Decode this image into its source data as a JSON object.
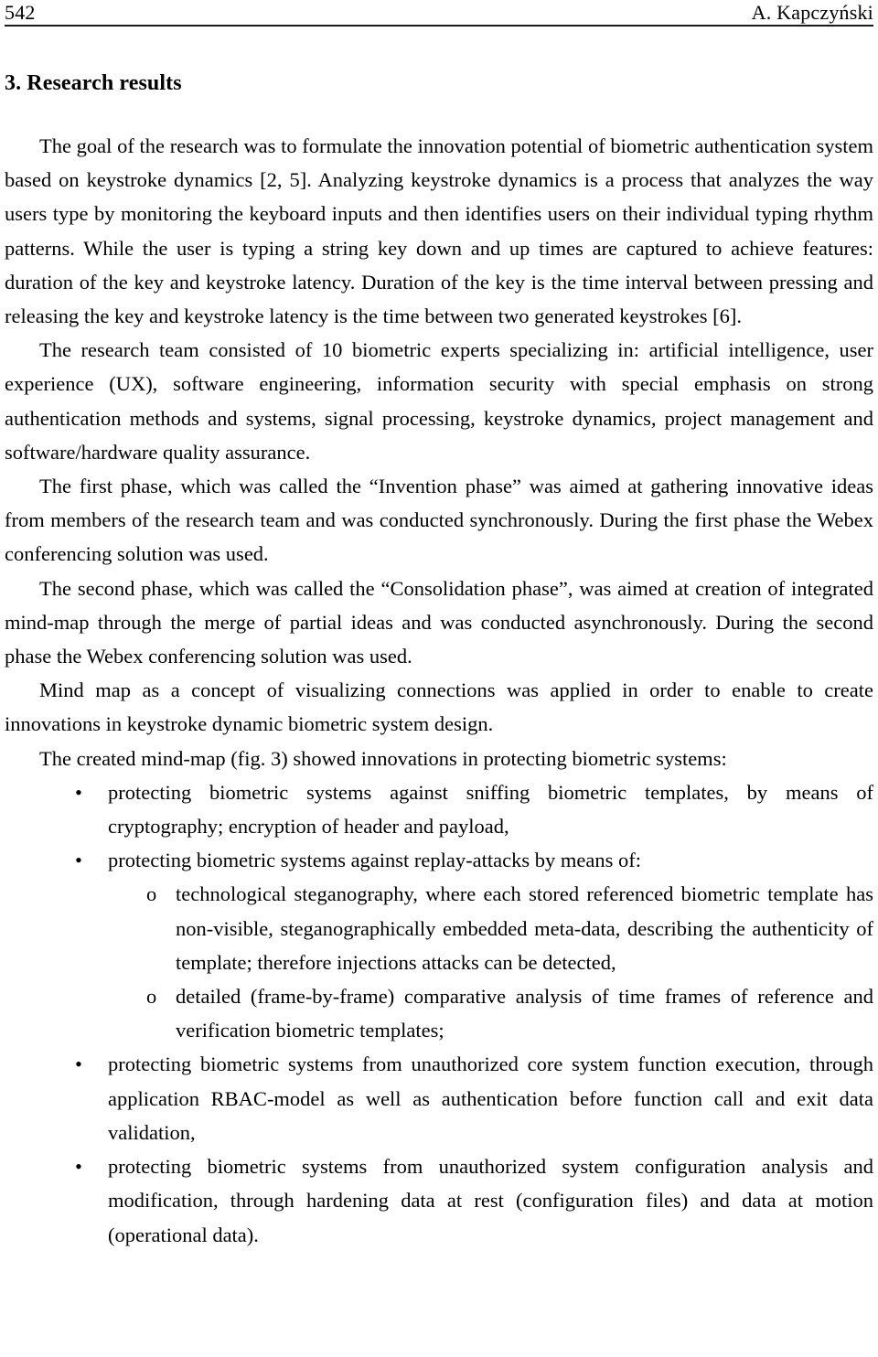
{
  "header": {
    "folio": "542",
    "author": "A. Kapczyński"
  },
  "section": {
    "heading": "3. Research results"
  },
  "paragraphs": [
    "The goal of the research was to formulate the innovation potential of biometric authentication system based on keystroke dynamics [2, 5]. Analyzing keystroke dynamics is a process that analyzes the way users type by monitoring the keyboard inputs and then identifies users on their individual typing rhythm patterns. While the user is typing a string key down and up times are captured to achieve features: duration of the key and keystroke latency. Duration of the key is the time interval between pressing and releasing the key and keystroke latency is the time between two generated keystrokes [6].",
    "The research team consisted of 10 biometric experts specializing in: artificial intelligence, user experience (UX), software engineering, information security with special emphasis on strong authentication methods and systems, signal processing, keystroke dynamics, project management and software/hardware quality assurance.",
    "The first phase, which was called the “Invention phase” was aimed at gathering innovative ideas from members of the research team and was conducted synchronously. During the first phase the Webex conferencing solution was used.",
    "The second phase, which was called the “Consolidation phase”, was aimed at creation of integrated mind-map through the merge of partial ideas and was conducted asynchronously. During the second phase the Webex conferencing solution was used.",
    "Mind map as a concept of visualizing connections was applied in order to enable to create innovations in keystroke dynamic biometric system design.",
    "The created mind-map (fig. 3) showed innovations in protecting biometric systems:"
  ],
  "markers": {
    "bullet": "•",
    "sub_bullet": "o"
  },
  "list": {
    "item1": "protecting biometric systems against sniffing biometric templates, by means of cryptography; encryption of header and payload,",
    "item2": "protecting biometric systems against replay-attacks by means of:",
    "item2_sub1": "technological steganography, where each stored referenced biometric template has non-visible, steganographically embedded meta-data, describing the authenticity of template; therefore injections attacks can be detected,",
    "item2_sub2": "detailed (frame-by-frame) comparative analysis of time frames of reference and verification biometric templates;",
    "item3": "protecting biometric systems from unauthorized core system function execution, through application RBAC-model as well as authentication before function call and exit data validation,",
    "item4": "protecting biometric systems from unauthorized system configuration analysis and modification, through hardening data at rest (configuration files) and data at motion (operational data)."
  }
}
